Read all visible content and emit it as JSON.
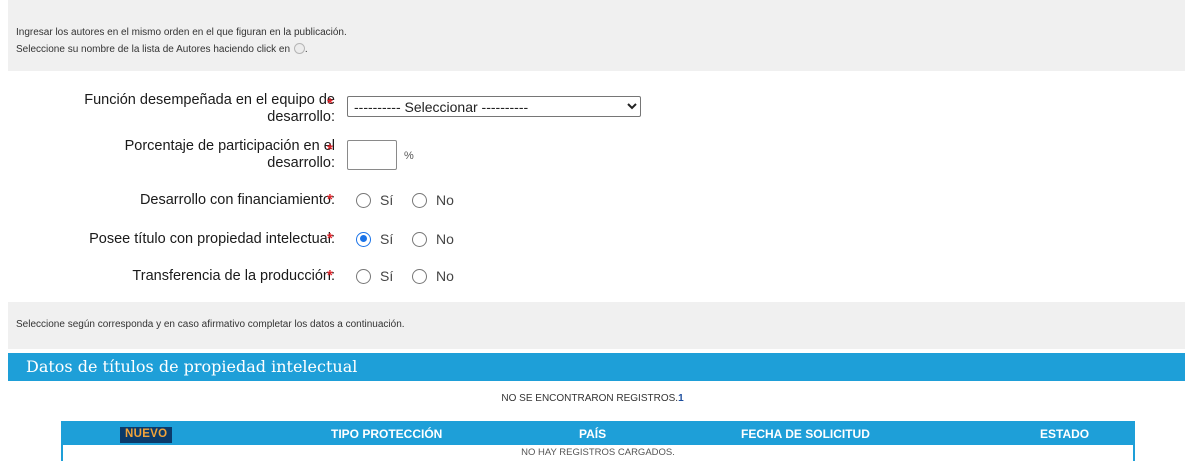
{
  "info": {
    "line1": "Ingresar los autores en el mismo orden en el que figuran en la publicación.",
    "line2": "Seleccione su nombre de la lista de Autores haciendo click en",
    "line2_suffix": ".",
    "note": "Seleccione según corresponda y en caso afirmativo completar los datos a continuación."
  },
  "form": {
    "funcion_label_1": "Función desempeñada en el equipo de",
    "funcion_label_2": "desarrollo:",
    "funcion_select": "---------- Seleccionar ----------",
    "porcentaje_label_1": "Porcentaje de participación en el",
    "porcentaje_label_2": "desarrollo:",
    "porcentaje_unit": "%",
    "financiamiento_label": "Desarrollo con financiamiento:",
    "titulo_label": "Posee título con propiedad intelectual:",
    "transferencia_label": "Transferencia de la producción:",
    "required_mark": "*",
    "opt_si": "Sí",
    "opt_no": "No",
    "titulo_selected": "Sí"
  },
  "section": {
    "title": "Datos de títulos de propiedad intelectual",
    "no_records": "NO SE ENCONTRARON REGISTROS.",
    "no_records_count": "1"
  },
  "table": {
    "nuevo_button": "NUEVO",
    "columns": [
      "TIPO PROTECCIÓN",
      "PAÍS",
      "FECHA DE SOLICITUD",
      "ESTADO"
    ],
    "empty_text": "NO HAY REGISTROS CARGADOS."
  },
  "colors": {
    "accent": "#1e9fd8",
    "required": "#e0262d",
    "button_bg": "#0b3a6a",
    "button_text": "#f2a33a"
  }
}
